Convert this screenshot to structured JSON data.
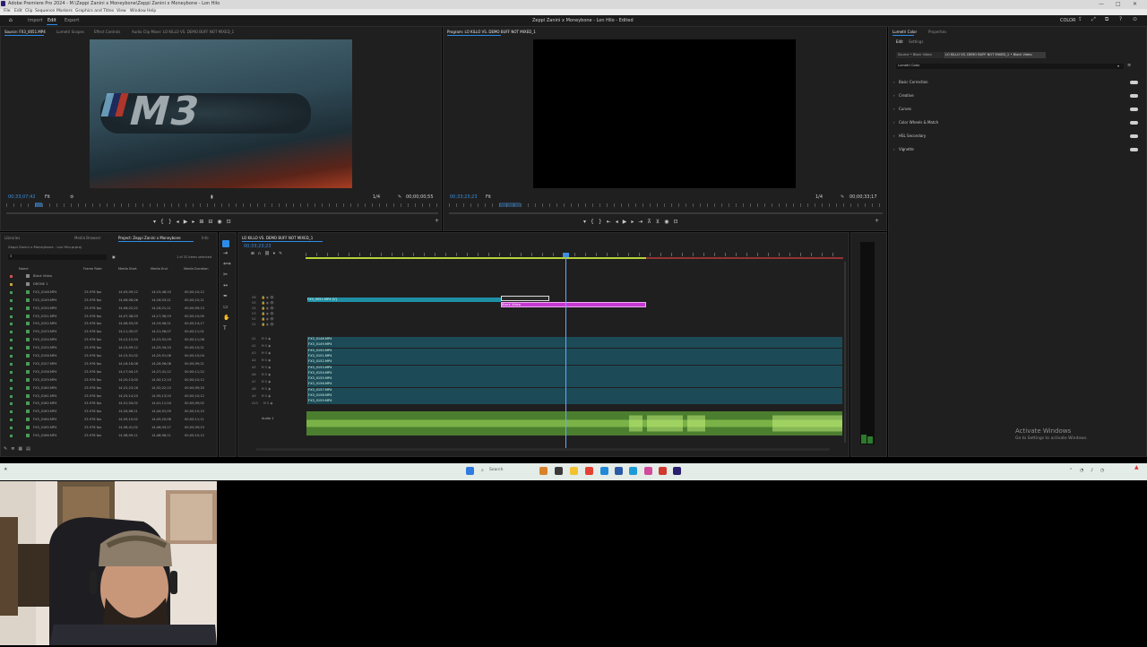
{
  "titlebar": {
    "title": "Adobe Premiere Pro 2024 - M:\\Zeppi Zanini x Moneybone\\Zeppi Zanini x Moneybone - Lon Hilo",
    "window_controls": [
      "—",
      "□",
      "✕"
    ]
  },
  "menubar": [
    "File",
    "Edit",
    "Clip",
    "Sequence",
    "Markers",
    "Graphics and Titles",
    "View",
    "Window",
    "Help"
  ],
  "workspace": {
    "tabs": [
      "Import",
      "Edit",
      "Export"
    ],
    "active_tab": "Edit",
    "center_title": "Zeppi Zanini x Moneybone - Lon Hilo - Edited",
    "color_label": "COLOR"
  },
  "source_monitor": {
    "tabs": [
      "Source: FX3_0051.MP4",
      "Lumetri Scopes",
      "Effect Controls",
      "Audio Clip Mixer: LO KILLO VS. DEMO BUFF NOT MIXED_1"
    ],
    "timecode_left": "00;33;07;42",
    "fit": "Fit",
    "quality": "1/4",
    "timecode_right": "00;00;00;55",
    "thumbnail_badge": "M3"
  },
  "program_monitor": {
    "tab": "Program: LO KILLO VS. DEMO BUFF NOT MIXED_1",
    "timecode_left": "00;33;23;23",
    "fit": "Fit",
    "quality": "1/4",
    "timecode_right": "00;00;33;17"
  },
  "lumetri": {
    "tabs": [
      "Lumetri Color",
      "Properties"
    ],
    "subtabs": [
      "Edit",
      "Settings"
    ],
    "source_label": "Source • Black Video",
    "target_label": "LO KILLO VS. DEMO BUFF NOT MIXED_1 • Black Video",
    "preset": "Lumetri Color",
    "sections": [
      "Basic Correction",
      "Creative",
      "Curves",
      "Color Wheels & Match",
      "HSL Secondary",
      "Vignette"
    ]
  },
  "project": {
    "tabs": [
      "Project: Zeppi Zanini x Moneybone",
      "Libraries",
      "Media Browser",
      "Info"
    ],
    "path": "Zeppi Zanini x Moneybone - Lon Hilo.prproj",
    "items_selected": "1 of 32 items selected",
    "columns": [
      "Name",
      "Frame Rate",
      "Media Start",
      "Media End",
      "Media Duration"
    ],
    "rows": [
      {
        "name": "Black Video",
        "rate": "",
        "start": "",
        "end": "",
        "dur": "",
        "color": "#d05050",
        "kind": "bin"
      },
      {
        "name": "DRONE 1",
        "rate": "",
        "start": "",
        "end": "",
        "dur": "",
        "color": "#c7a23a",
        "kind": "bin"
      },
      {
        "name": "FX3_0148.MP4",
        "rate": "23.976 fps",
        "start": "14;05;09;12",
        "end": "14;15;48;10",
        "dur": "00;00;10;12",
        "color": "#4b9a58",
        "kind": "clip"
      },
      {
        "name": "FX3_0149.MP4",
        "rate": "23.976 fps",
        "start": "14;06;06;06",
        "end": "14;16;03;21",
        "dur": "00;00;10;11",
        "color": "#4b9a58",
        "kind": "clip"
      },
      {
        "name": "FX3_0150.MP4",
        "rate": "23.976 fps",
        "start": "14;06;22;22",
        "end": "14;16;21;11",
        "dur": "00;00;09;13",
        "color": "#4b9a58",
        "kind": "clip"
      },
      {
        "name": "FX3_0151.MP4",
        "rate": "23.976 fps",
        "start": "14;07;38;20",
        "end": "14;17;38;19",
        "dur": "00;00;10;00",
        "color": "#4b9a58",
        "kind": "clip"
      },
      {
        "name": "FX3_0152.MP4",
        "rate": "23.976 fps",
        "start": "14;08;55;05",
        "end": "14;19;08;21",
        "dur": "00;00;14;17",
        "color": "#4b9a58",
        "kind": "clip"
      },
      {
        "name": "FX3_0153.MP4",
        "rate": "23.976 fps",
        "start": "14;11;45;07",
        "end": "14;21;56;07",
        "dur": "00;00;11;01",
        "color": "#4b9a58",
        "kind": "clip"
      },
      {
        "name": "FX3_0154.MP4",
        "rate": "23.976 fps",
        "start": "14;12;12;04",
        "end": "14;23;52;09",
        "dur": "00;00;11;06",
        "color": "#4b9a58",
        "kind": "clip"
      },
      {
        "name": "FX3_0155.MP4",
        "rate": "23.976 fps",
        "start": "14;15;09;12",
        "end": "14;25;34;10",
        "dur": "00;00;10;21",
        "color": "#4b9a58",
        "kind": "clip"
      },
      {
        "name": "FX3_0156.MP4",
        "rate": "23.976 fps",
        "start": "14;15;51;02",
        "end": "14;25;51;06",
        "dur": "00;00;10;04",
        "color": "#4b9a58",
        "kind": "clip"
      },
      {
        "name": "FX3_0157.MP4",
        "rate": "23.976 fps",
        "start": "14;16;18;08",
        "end": "14;26;56;08",
        "dur": "00;00;09;21",
        "color": "#4b9a58",
        "kind": "clip"
      },
      {
        "name": "FX3_0158.MP4",
        "rate": "23.976 fps",
        "start": "14;17;04;15",
        "end": "14;27;41;12",
        "dur": "00;00;11;22",
        "color": "#4b9a58",
        "kind": "clip"
      },
      {
        "name": "FX3_0159.MP4",
        "rate": "23.976 fps",
        "start": "14;20;13;00",
        "end": "14;30;12;10",
        "dur": "00;00;10;12",
        "color": "#4b9a58",
        "kind": "clip"
      },
      {
        "name": "FX3_0160.MP4",
        "rate": "23.976 fps",
        "start": "14;22;23;16",
        "end": "14;32;22;15",
        "dur": "00;00;09;20",
        "color": "#4b9a58",
        "kind": "clip"
      },
      {
        "name": "FX3_0161.MP4",
        "rate": "23.976 fps",
        "start": "14;25;14;20",
        "end": "14;35;13;20",
        "dur": "00;00;10;12",
        "color": "#4b9a58",
        "kind": "clip"
      },
      {
        "name": "FX3_0162.MP4",
        "rate": "23.976 fps",
        "start": "14;31;04;02",
        "end": "14;41;11;04",
        "dur": "00;00;09;02",
        "color": "#4b9a58",
        "kind": "clip"
      },
      {
        "name": "FX3_0163.MP4",
        "rate": "23.976 fps",
        "start": "14;34;08;21",
        "end": "14;44;01;09",
        "dur": "00;00;10;15",
        "color": "#4b9a58",
        "kind": "clip"
      },
      {
        "name": "FX3_0164.MP4",
        "rate": "23.976 fps",
        "start": "14;35;10;02",
        "end": "14;45;20;06",
        "dur": "00;00;11;11",
        "color": "#4b9a58",
        "kind": "clip"
      },
      {
        "name": "FX3_0165.MP4",
        "rate": "23.976 fps",
        "start": "14;36;41;02",
        "end": "14;46;43;17",
        "dur": "00;00;09;23",
        "color": "#4b9a58",
        "kind": "clip"
      },
      {
        "name": "FX3_0166.MP4",
        "rate": "23.976 fps",
        "start": "14;38;09;11",
        "end": "14;48;08;11",
        "dur": "00;00;10;12",
        "color": "#4b9a58",
        "kind": "clip"
      }
    ]
  },
  "timeline": {
    "tab": "LO KILLO VS. DEMO BUFF NOT MIXED_1",
    "timecode": "00;33;23;23",
    "title_clip": "Black Video",
    "v_clip": "FX3_0051.MP4 [V]",
    "video_tracks": [
      "V6",
      "V5",
      "V4",
      "V3",
      "V2",
      "V1"
    ],
    "audio_tracks": [
      "A1",
      "A2",
      "A3",
      "A4",
      "A5",
      "A6",
      "A7",
      "A8",
      "A9",
      "A10"
    ],
    "audio_clips": [
      "FX3_0148.MP4",
      "FX3_0149.MP4",
      "FX3_0150.MP4",
      "FX3_0151.MP4",
      "FX3_0152.MP4",
      "FX3_0153.MP4",
      "FX3_0154.MP4",
      "FX3_0155.MP4",
      "FX3_0156.MP4",
      "FX3_0157.MP4",
      "FX3_0158.MP4",
      "FX3_0159.MP4"
    ],
    "music_track_label": "Audio 1"
  },
  "activation": {
    "title": "Activate Windows",
    "subtitle": "Go to Settings to activate Windows."
  },
  "taskbar": {
    "search_label": "Search"
  },
  "colors": {
    "accent": "#2d8ceb",
    "title_clip": "#c43ad0",
    "video_clip": "#1f8fa6",
    "audio_clip": "#1c4a57",
    "music_wave": "#6db63a"
  }
}
